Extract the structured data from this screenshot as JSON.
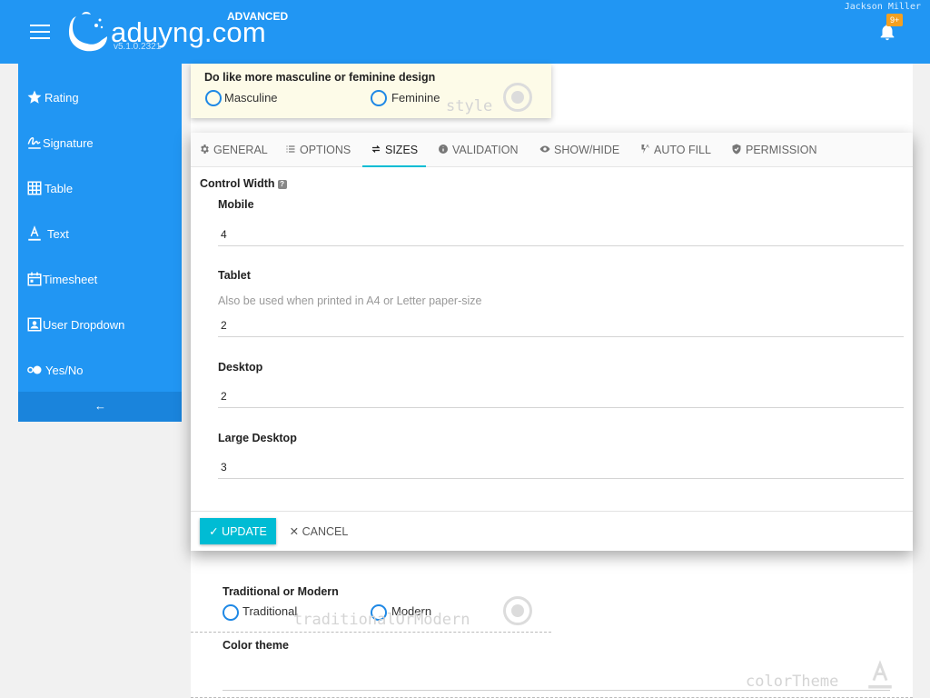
{
  "header": {
    "brand": "aduyng.com",
    "version": "v5.1.0.2321",
    "edition": "ADVANCED",
    "user": "Jackson Miller",
    "notification_badge": "9+",
    "accent": "#2196f3"
  },
  "sidebar": {
    "items": [
      {
        "label": "Rating",
        "icon": "star-icon"
      },
      {
        "label": "Signature",
        "icon": "signature-icon"
      },
      {
        "label": "Table",
        "icon": "table-icon"
      },
      {
        "label": "Text",
        "icon": "text-icon"
      },
      {
        "label": "Timesheet",
        "icon": "calendar-icon"
      },
      {
        "label": "User Dropdown",
        "icon": "user-icon"
      },
      {
        "label": "Yes/No",
        "icon": "toggle-icon"
      }
    ],
    "collapse_label": "←"
  },
  "style_question": {
    "title": "Do like more masculine or feminine design",
    "options": [
      "Masculine",
      "Feminine"
    ],
    "watermark": "style"
  },
  "dialog": {
    "tabs": [
      {
        "label": "GENERAL",
        "icon": "gear-icon"
      },
      {
        "label": "OPTIONS",
        "icon": "list-icon"
      },
      {
        "label": "SIZES",
        "icon": "swap-icon"
      },
      {
        "label": "VALIDATION",
        "icon": "info-icon"
      },
      {
        "label": "SHOW/HIDE",
        "icon": "eye-icon"
      },
      {
        "label": "AUTO FILL",
        "icon": "autofill-icon"
      },
      {
        "label": "PERMISSION",
        "icon": "shield-icon"
      }
    ],
    "active_tab": "SIZES",
    "section_title": "Control Width",
    "help_glyph": "?",
    "fields": {
      "mobile": {
        "label": "Mobile",
        "value": "4"
      },
      "tablet": {
        "label": "Tablet",
        "hint": "Also be used when printed in A4 or Letter paper-size",
        "value": "2"
      },
      "desktop": {
        "label": "Desktop",
        "value": "2"
      },
      "large_desktop": {
        "label": "Large Desktop",
        "value": "3"
      }
    },
    "update_label": "✓ UPDATE",
    "cancel_label": "✕ CANCEL",
    "update_color": "#00bcd4"
  },
  "tradition_question": {
    "title": "Traditional or Modern",
    "options": [
      "Traditional",
      "Modern"
    ],
    "watermark": "traditionalOrModern"
  },
  "color_question": {
    "title": "Color theme",
    "watermark": "colorTheme"
  }
}
